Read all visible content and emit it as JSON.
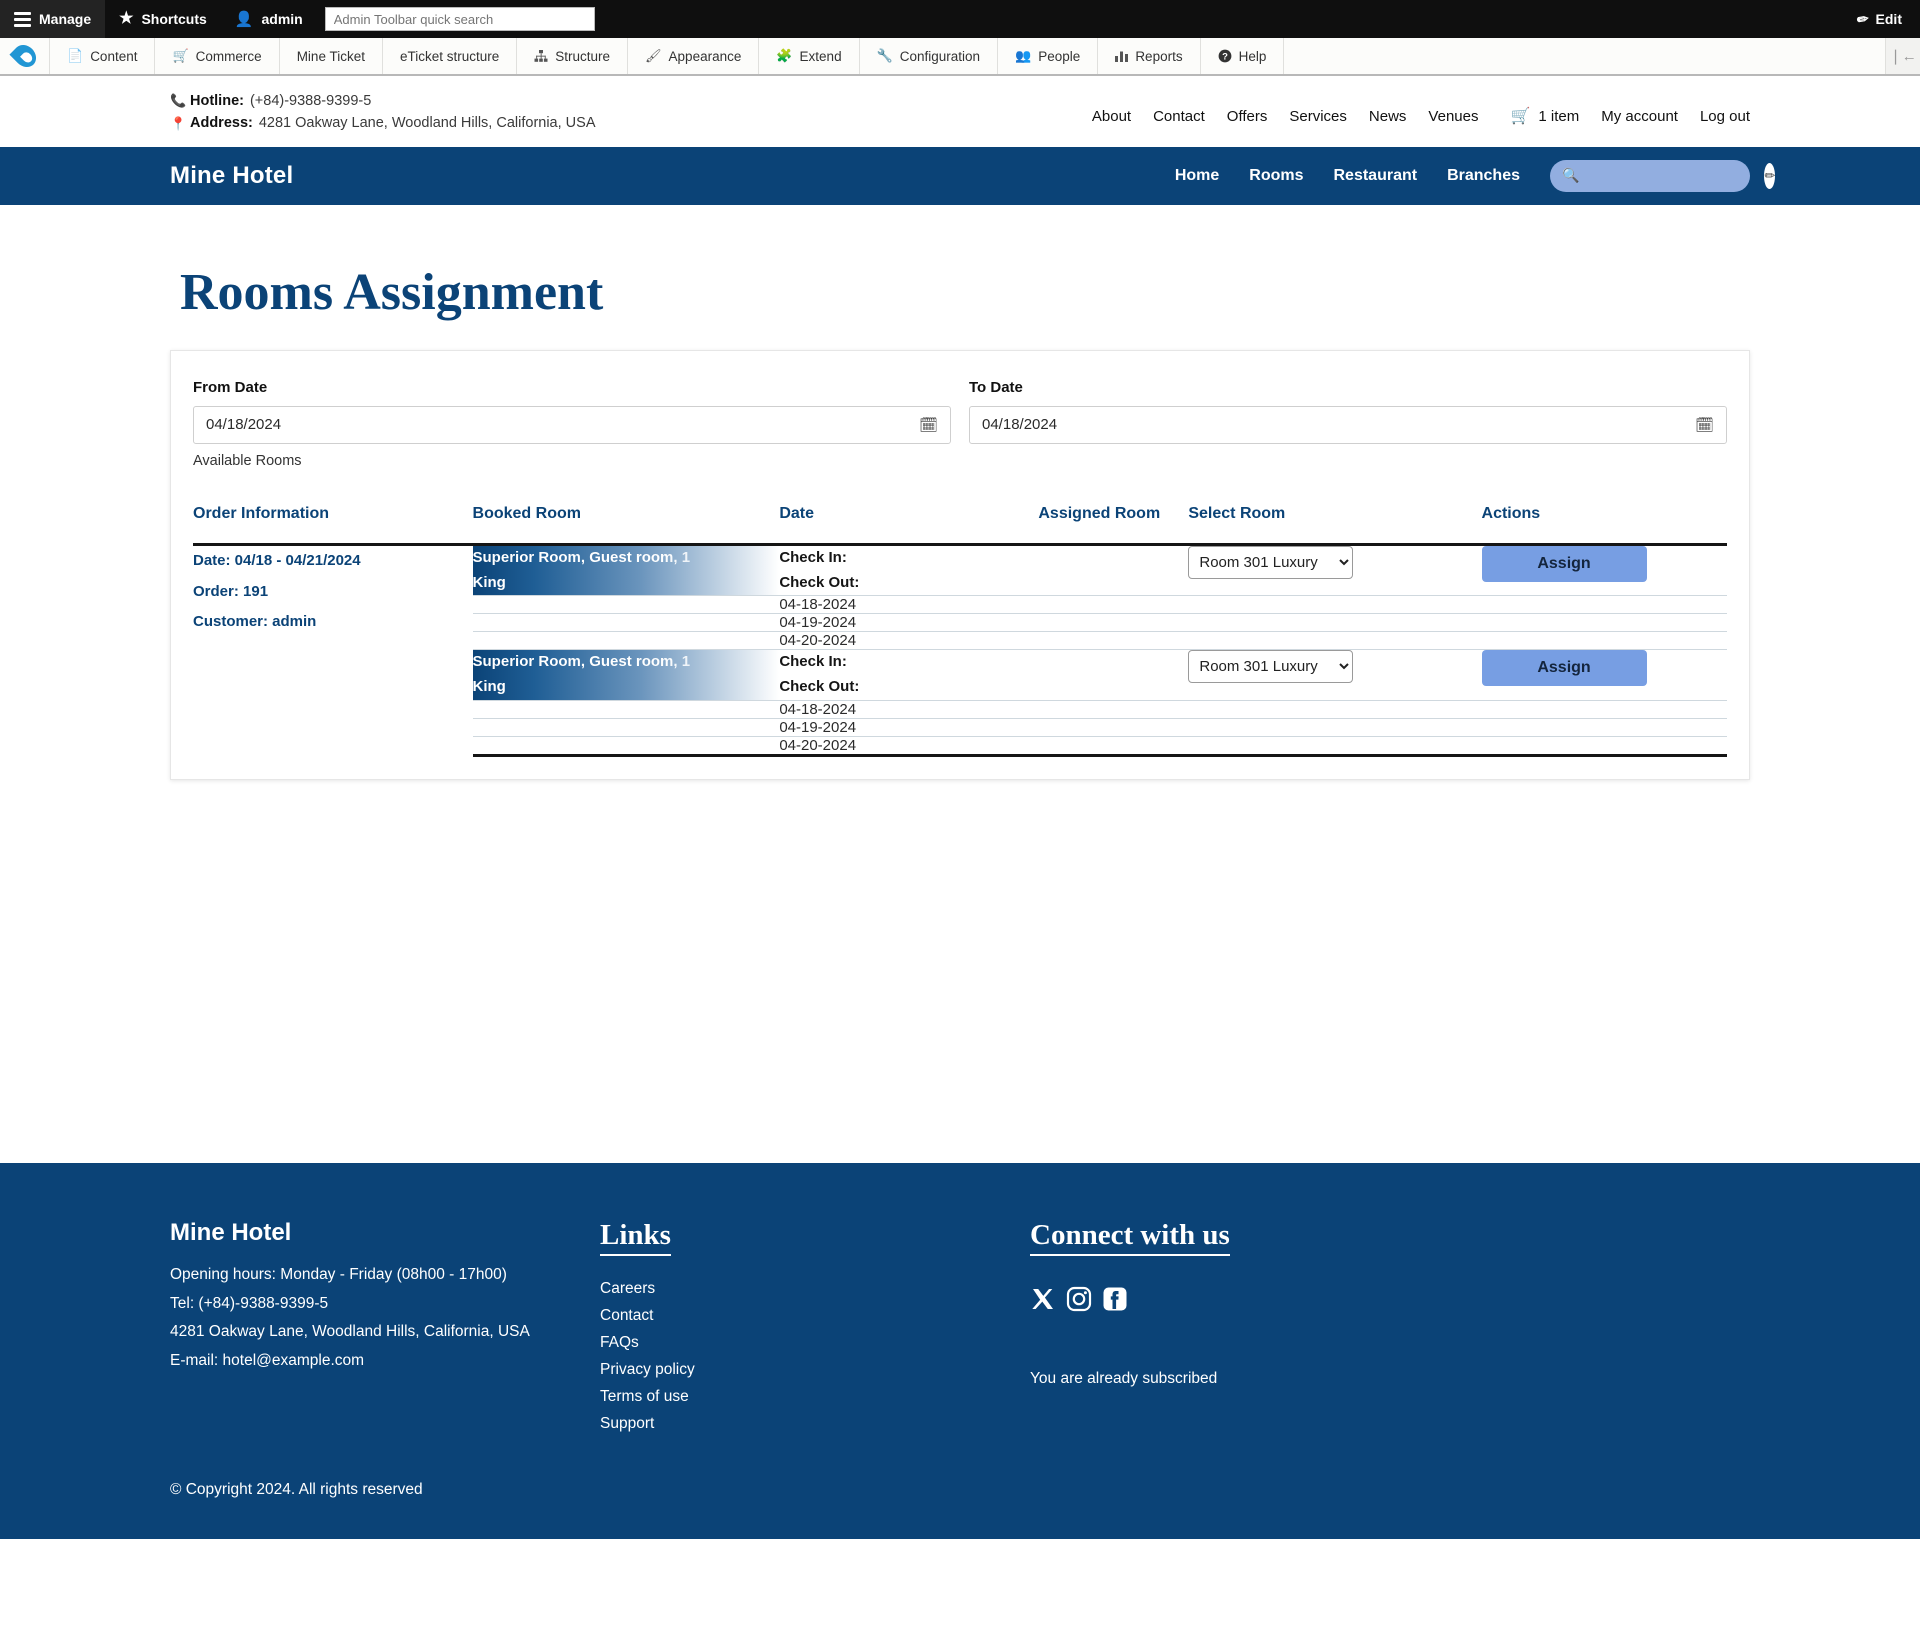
{
  "admin_toolbar": {
    "manage_label": "Manage",
    "shortcuts_label": "Shortcuts",
    "user_label": "admin",
    "search_placeholder": "Admin Toolbar quick search",
    "search_value": "",
    "edit_label": "Edit",
    "tabs": [
      {
        "label": "Content",
        "icon": "file-icon"
      },
      {
        "label": "Commerce",
        "icon": "cart-icon"
      },
      {
        "label": "Mine Ticket",
        "icon": ""
      },
      {
        "label": "eTicket structure",
        "icon": ""
      },
      {
        "label": "Structure",
        "icon": "sitemap-icon"
      },
      {
        "label": "Appearance",
        "icon": "brush-icon"
      },
      {
        "label": "Extend",
        "icon": "puzzle-icon"
      },
      {
        "label": "Configuration",
        "icon": "wrench-icon"
      },
      {
        "label": "People",
        "icon": "people-icon"
      },
      {
        "label": "Reports",
        "icon": "bars-icon"
      },
      {
        "label": "Help",
        "icon": "question-icon"
      }
    ]
  },
  "topbar": {
    "hotline_label": "Hotline:",
    "hotline_value": "(+84)-9388-9399-5",
    "address_label": "Address:",
    "address_value": "4281 Oakway Lane, Woodland Hills, California, USA",
    "links": [
      "About",
      "Contact",
      "Offers",
      "Services",
      "News",
      "Venues"
    ],
    "cart_label": "1 item",
    "account_label": "My account",
    "logout_label": "Log out"
  },
  "mainnav": {
    "brand": "Mine Hotel",
    "links": [
      "Home",
      "Rooms",
      "Restaurant",
      "Branches"
    ],
    "search_placeholder": "",
    "search_value": ""
  },
  "main": {
    "page_title": "Rooms Assignment",
    "from_date_label": "From Date",
    "from_date_value": "04/18/2024",
    "to_date_label": "To Date",
    "to_date_value": "04/18/2024",
    "available_rooms_note": "Available Rooms",
    "table": {
      "headers": [
        "Order Information",
        "Booked Room",
        "Date",
        "Assigned Room",
        "Select Room",
        "Actions"
      ],
      "groups": [
        {
          "order": {
            "date": "Date: 04/18 - 04/21/2024",
            "order_id": "Order: 191",
            "customer": "Customer: admin"
          },
          "booked_room_line1": "Superior Room, Guest room, 1",
          "booked_room_line2": "King",
          "check_in_label": "Check In:",
          "check_out_label": "Check Out:",
          "assigned_room": "",
          "selected_room": "Room 301 Luxury",
          "room_options": [
            "Room 301 Luxury"
          ],
          "action_label": "Assign",
          "dates": [
            "04-18-2024",
            "04-19-2024",
            "04-20-2024"
          ]
        },
        {
          "order": {
            "date": "",
            "order_id": "",
            "customer": ""
          },
          "booked_room_line1": "Superior Room, Guest room, 1",
          "booked_room_line2": "King",
          "check_in_label": "Check In:",
          "check_out_label": "Check Out:",
          "assigned_room": "",
          "selected_room": "Room 301 Luxury",
          "room_options": [
            "Room 301 Luxury"
          ],
          "action_label": "Assign",
          "dates": [
            "04-18-2024",
            "04-19-2024",
            "04-20-2024"
          ]
        }
      ]
    }
  },
  "footer": {
    "brand": "Mine Hotel",
    "opening_hours": "Opening hours: Monday - Friday (08h00 - 17h00)",
    "tel": "Tel: (+84)-9388-9399-5",
    "address": "4281 Oakway Lane, Woodland Hills, California, USA",
    "email": "E-mail: hotel@example.com",
    "links_title": "Links",
    "links": [
      "Careers",
      "Contact",
      "FAQs",
      "Privacy policy",
      "Terms of use",
      "Support"
    ],
    "connect_title": "Connect with us",
    "socials": [
      "x-icon",
      "instagram-icon",
      "facebook-icon"
    ],
    "subscribe_status": "You are already subscribed",
    "copyright": "© Copyright 2024. All rights reserved"
  },
  "colors": {
    "brand_blue": "#0b4377",
    "button_blue": "#779ee3",
    "admin_black": "#0f0f0f"
  }
}
